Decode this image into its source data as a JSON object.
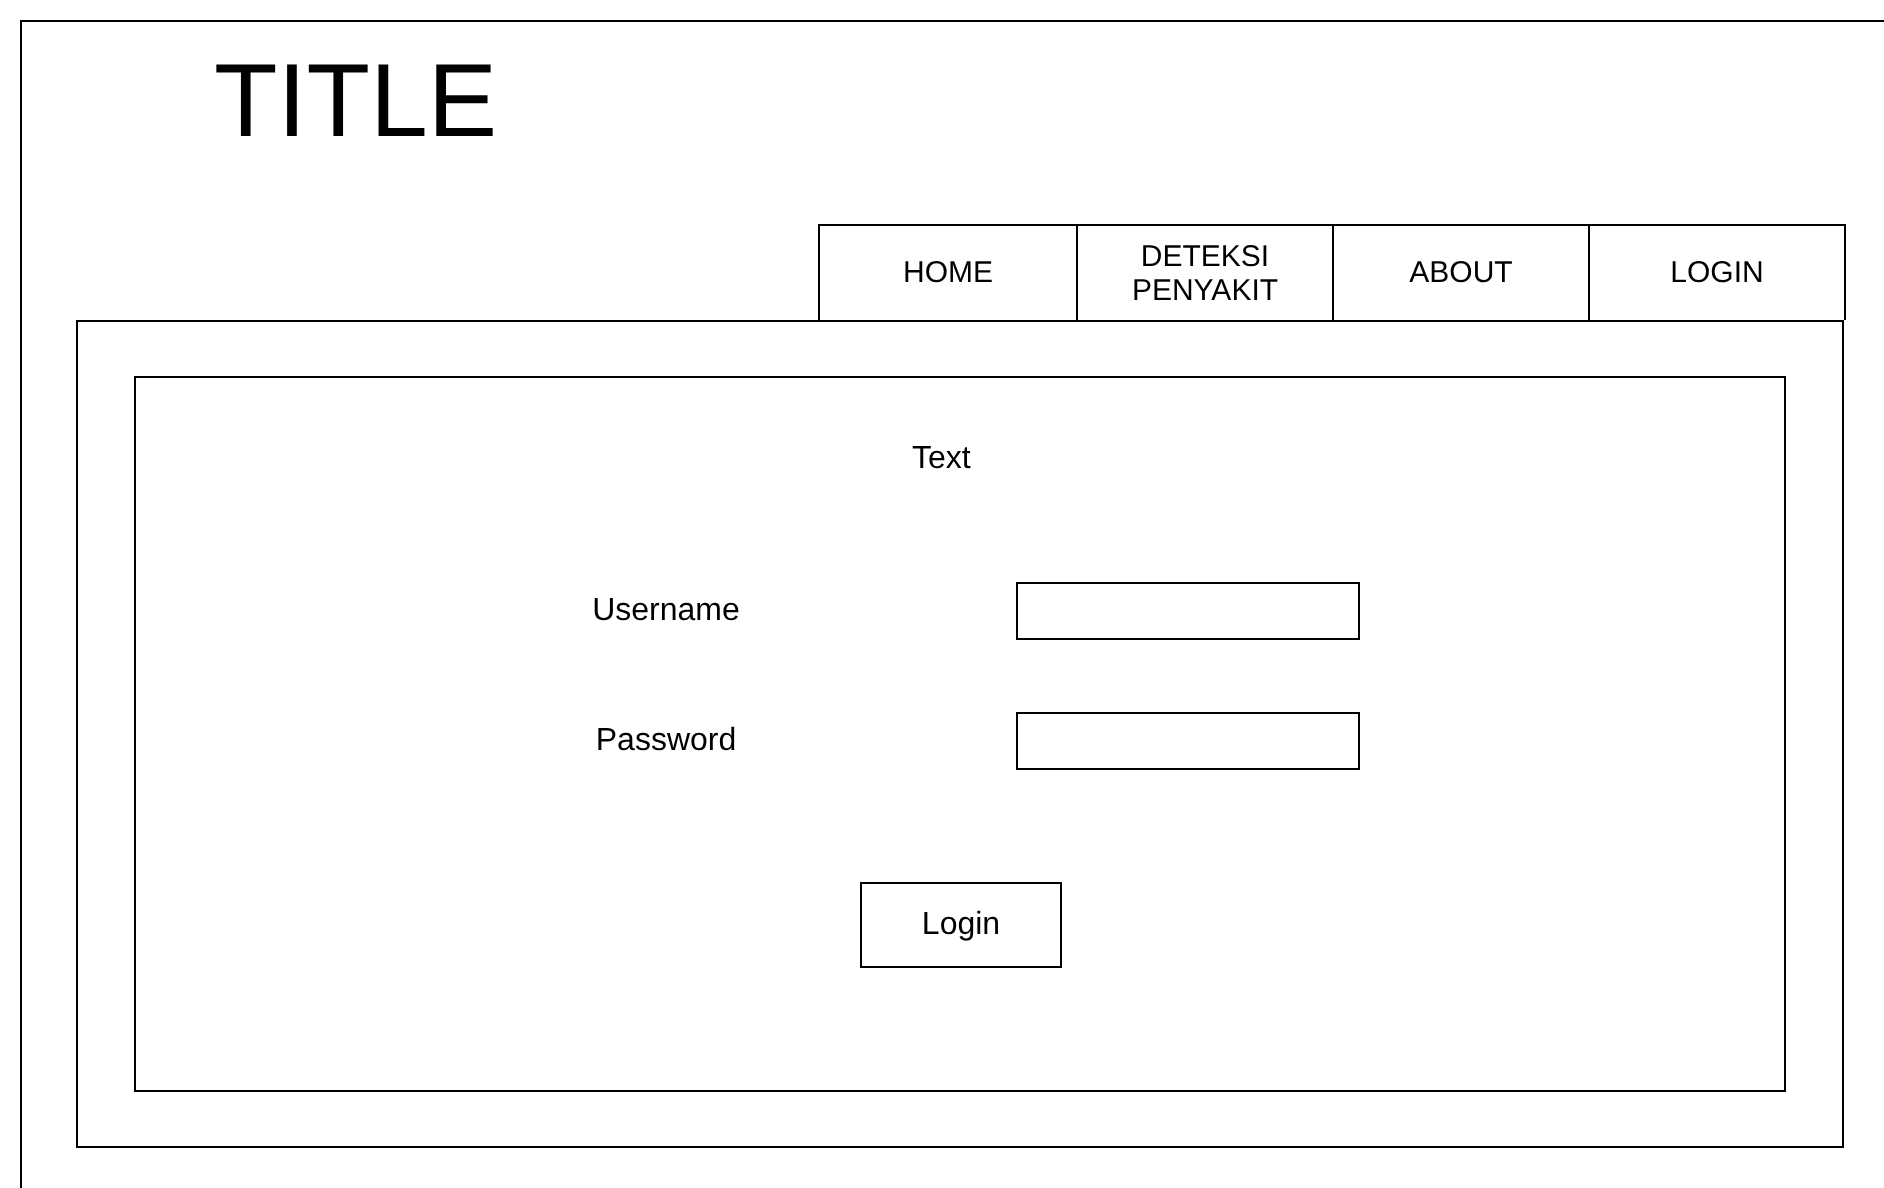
{
  "title": "TITLE",
  "nav": [
    {
      "label": "HOME"
    },
    {
      "label": "DETEKSI PENYAKIT"
    },
    {
      "label": "ABOUT"
    },
    {
      "label": "LOGIN"
    }
  ],
  "form": {
    "heading": "Text",
    "fields": [
      {
        "label": "Username"
      },
      {
        "label": "Password"
      }
    ],
    "button": "Login"
  }
}
